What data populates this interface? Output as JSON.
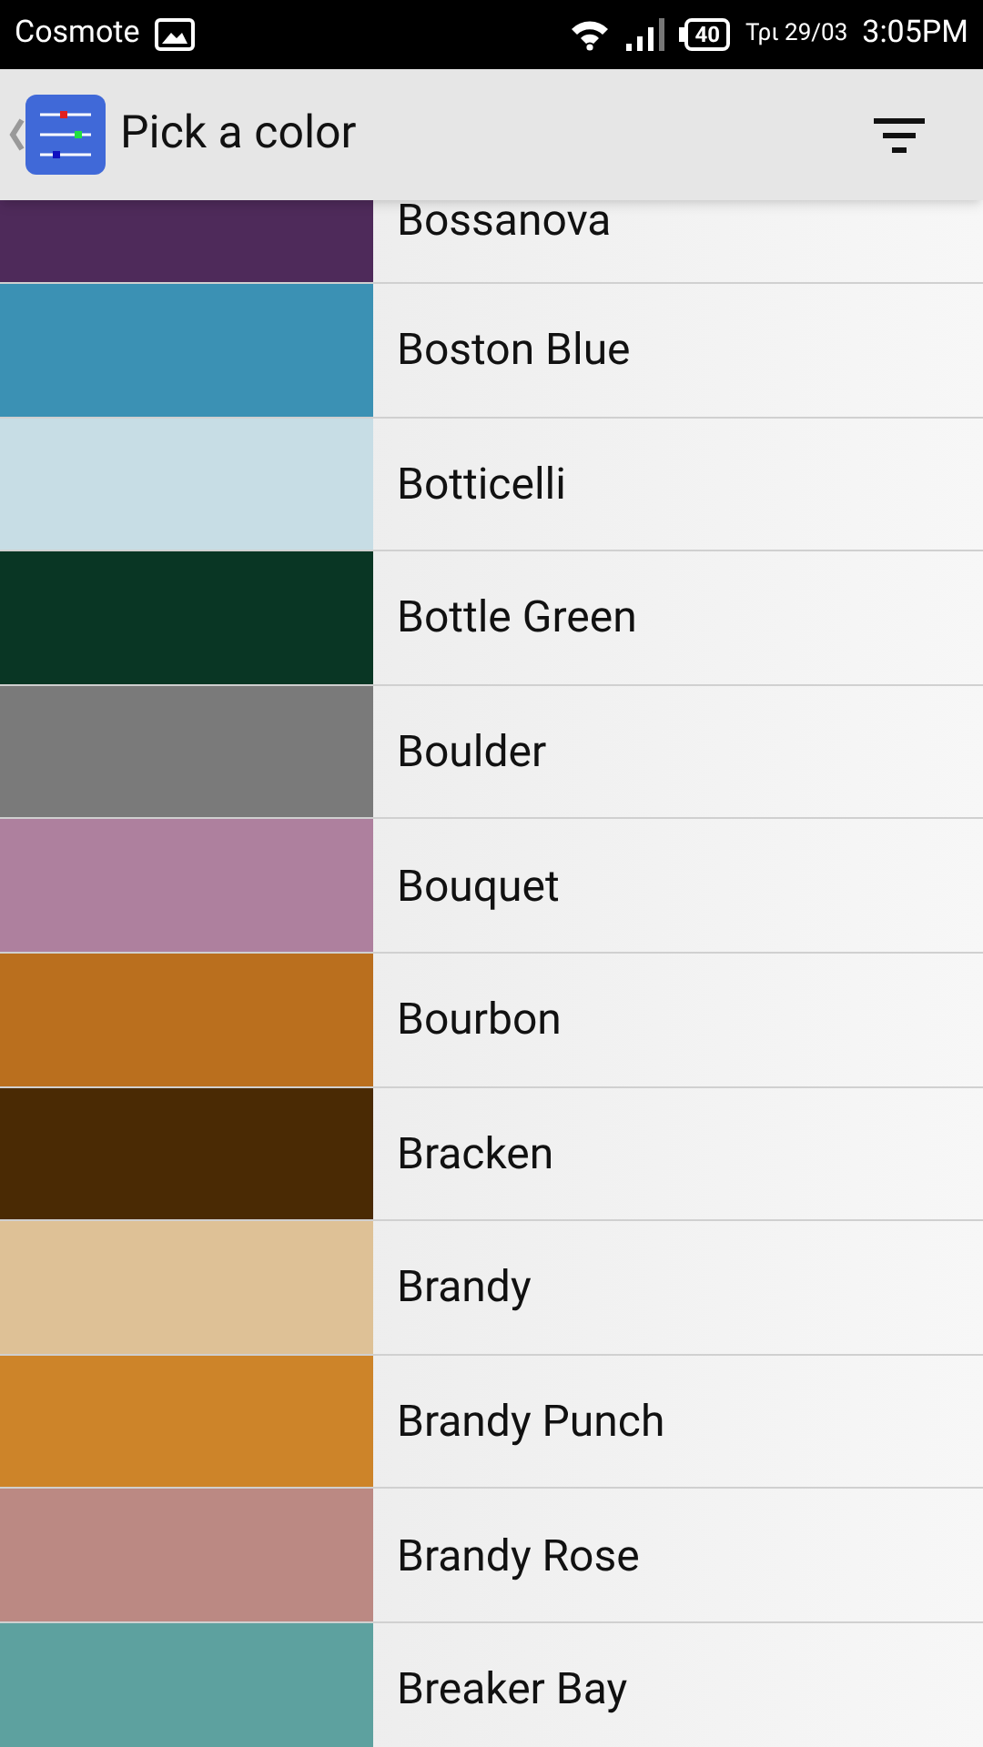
{
  "status_bar": {
    "carrier": "Cosmote",
    "battery": "40",
    "date": "Τρι 29/03",
    "time": "3:05PM"
  },
  "app_bar": {
    "title": "Pick a color"
  },
  "colors": [
    {
      "name": "Bossanova",
      "color": "#4e2a5a"
    },
    {
      "name": "Boston Blue",
      "color": "#3b91b4"
    },
    {
      "name": "Botticelli",
      "color": "#c7dde5"
    },
    {
      "name": "Bottle Green",
      "color": "#093624"
    },
    {
      "name": "Boulder",
      "color": "#7a7a7a"
    },
    {
      "name": "Bouquet",
      "color": "#ae809e"
    },
    {
      "name": "Bourbon",
      "color": "#ba6f1e"
    },
    {
      "name": "Bracken",
      "color": "#4a2a04"
    },
    {
      "name": "Brandy",
      "color": "#dec196"
    },
    {
      "name": "Brandy Punch",
      "color": "#cd8429"
    },
    {
      "name": "Brandy Rose",
      "color": "#bb8983"
    },
    {
      "name": "Breaker Bay",
      "color": "#5da19f"
    }
  ]
}
